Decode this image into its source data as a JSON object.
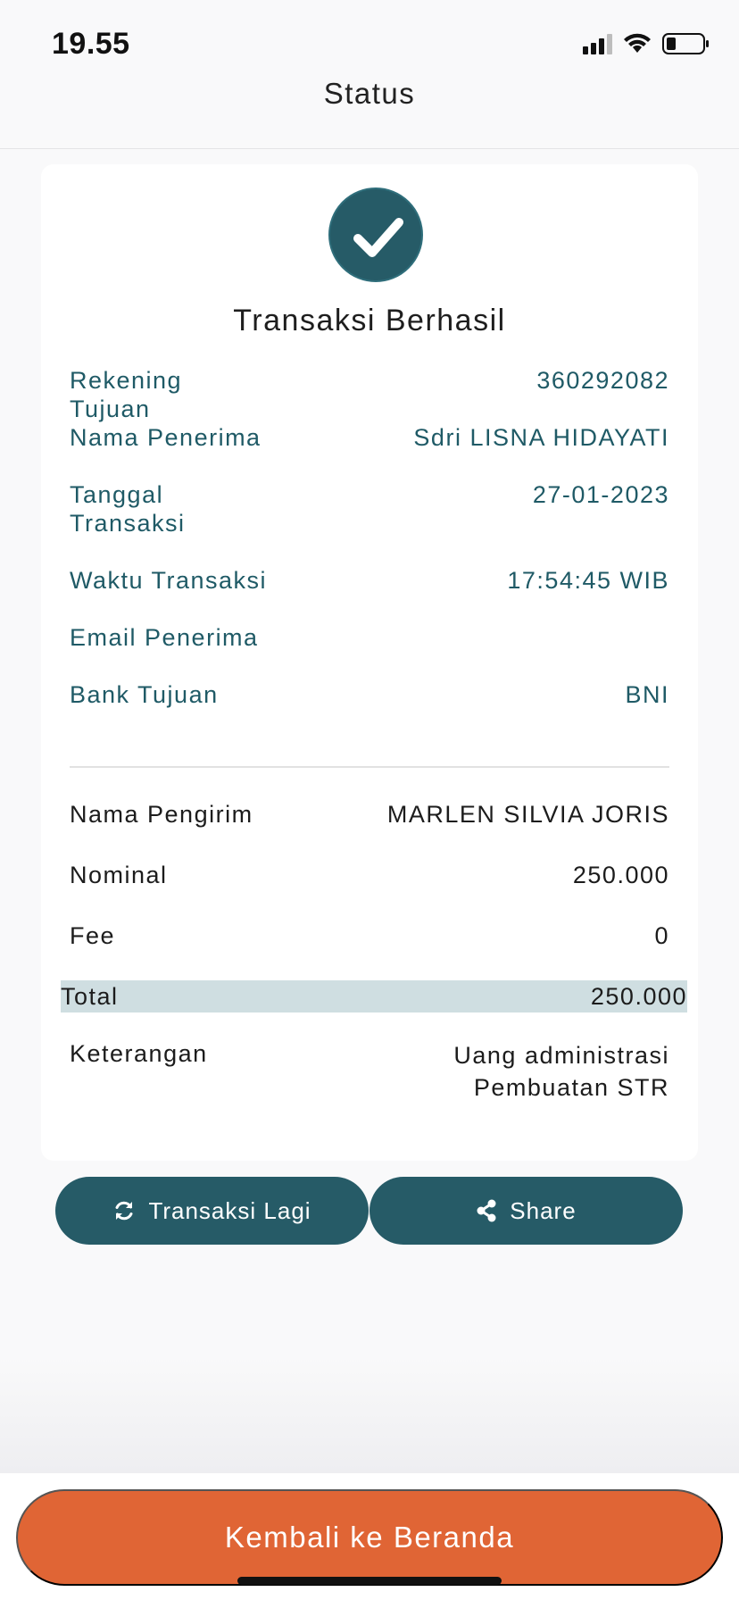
{
  "status_bar": {
    "time": "19.55"
  },
  "header": {
    "title": "Status"
  },
  "card": {
    "title": "Transaksi Berhasil",
    "recipient_details": [
      {
        "label": "Rekening Tujuan",
        "value": "360292082"
      },
      {
        "label": "Nama Penerima",
        "value": "Sdri LISNA HIDAYATI"
      },
      {
        "label": "Tanggal Transaksi",
        "value": "27-01-2023"
      },
      {
        "label": "Waktu Transaksi",
        "value": "17:54:45 WIB"
      },
      {
        "label": "Email Penerima",
        "value": ""
      },
      {
        "label": "Bank Tujuan",
        "value": "BNI"
      }
    ],
    "sender_details": [
      {
        "label": "Nama Pengirim",
        "value": "MARLEN SILVIA JORIS"
      },
      {
        "label": "Nominal",
        "value": "250.000"
      },
      {
        "label": "Fee",
        "value": "0"
      }
    ],
    "total": {
      "label": "Total",
      "value": "250.000"
    },
    "note": {
      "label": "Keterangan",
      "value": "Uang administrasi Pembuatan STR"
    }
  },
  "actions": {
    "again_label": "Transaksi Lagi",
    "share_label": "Share",
    "home_label": "Kembali ke Beranda"
  },
  "colors": {
    "primary": "#265b67",
    "accent": "#e06535",
    "total_highlight": "#cfdee1"
  },
  "icons": {
    "success": "check-icon",
    "again": "refresh-icon",
    "share": "share-icon"
  }
}
